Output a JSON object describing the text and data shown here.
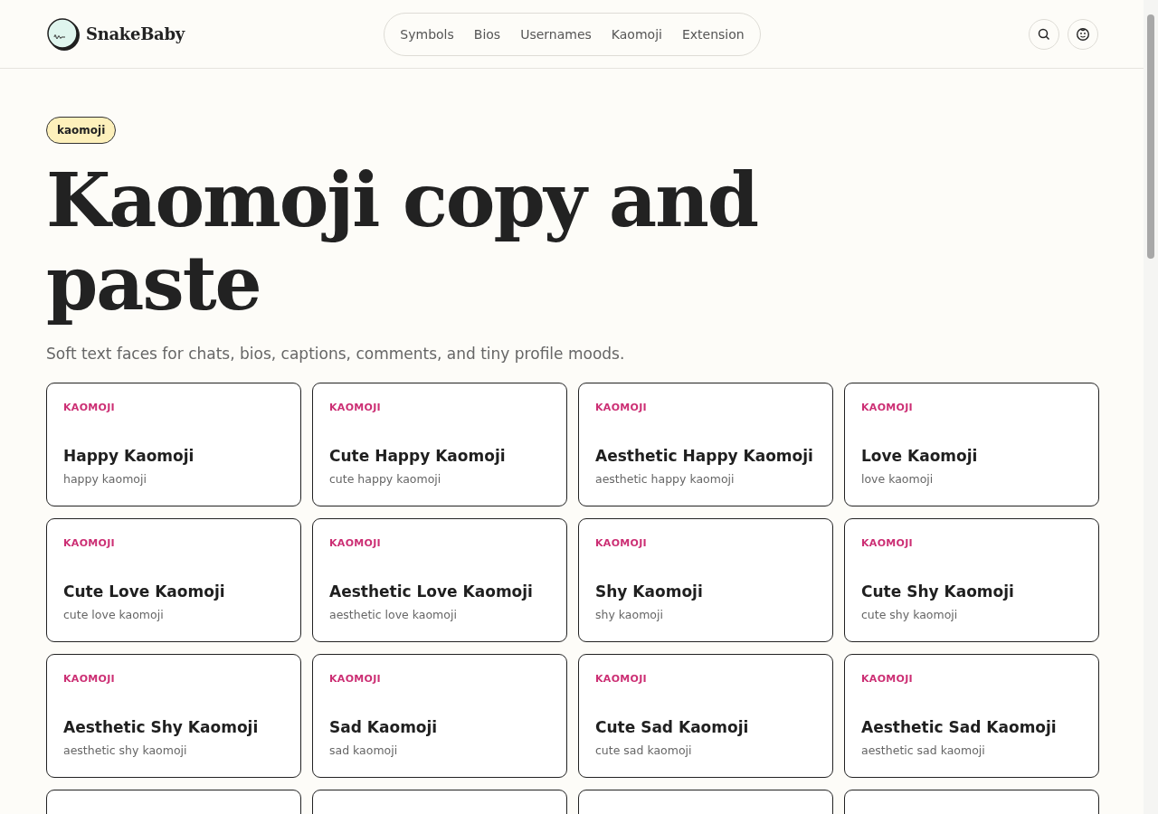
{
  "brand": {
    "name": "SnakeBaby"
  },
  "nav": [
    "Symbols",
    "Bios",
    "Usernames",
    "Kaomoji",
    "Extension"
  ],
  "badge": "kaomoji",
  "title": "Kaomoji copy and paste",
  "subtitle": "Soft text faces for chats, bios, captions, comments, and tiny profile moods.",
  "cards": [
    {
      "tag": "KAOMOJI",
      "title": "Happy Kaomoji",
      "subtitle": "happy kaomoji"
    },
    {
      "tag": "KAOMOJI",
      "title": "Cute Happy Kaomoji",
      "subtitle": "cute happy kaomoji"
    },
    {
      "tag": "KAOMOJI",
      "title": "Aesthetic Happy Kaomoji",
      "subtitle": "aesthetic happy kaomoji"
    },
    {
      "tag": "KAOMOJI",
      "title": "Love Kaomoji",
      "subtitle": "love kaomoji"
    },
    {
      "tag": "KAOMOJI",
      "title": "Cute Love Kaomoji",
      "subtitle": "cute love kaomoji"
    },
    {
      "tag": "KAOMOJI",
      "title": "Aesthetic Love Kaomoji",
      "subtitle": "aesthetic love kaomoji"
    },
    {
      "tag": "KAOMOJI",
      "title": "Shy Kaomoji",
      "subtitle": "shy kaomoji"
    },
    {
      "tag": "KAOMOJI",
      "title": "Cute Shy Kaomoji",
      "subtitle": "cute shy kaomoji"
    },
    {
      "tag": "KAOMOJI",
      "title": "Aesthetic Shy Kaomoji",
      "subtitle": "aesthetic shy kaomoji"
    },
    {
      "tag": "KAOMOJI",
      "title": "Sad Kaomoji",
      "subtitle": "sad kaomoji"
    },
    {
      "tag": "KAOMOJI",
      "title": "Cute Sad Kaomoji",
      "subtitle": "cute sad kaomoji"
    },
    {
      "tag": "KAOMOJI",
      "title": "Aesthetic Sad Kaomoji",
      "subtitle": "aesthetic sad kaomoji"
    }
  ]
}
